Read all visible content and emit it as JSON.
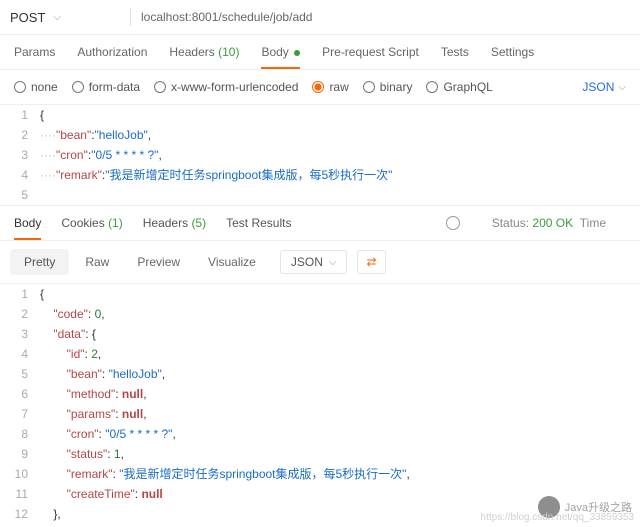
{
  "top": {
    "method": "POST",
    "url": "localhost:8001/schedule/job/add"
  },
  "tabs1": {
    "items": [
      "Params",
      "Authorization",
      "Headers",
      "Body",
      "Pre-request Script",
      "Tests",
      "Settings"
    ],
    "headersCount": "(10)"
  },
  "radios": {
    "items": [
      "none",
      "form-data",
      "x-www-form-urlencoded",
      "raw",
      "binary",
      "GraphQL"
    ],
    "jsonSel": "JSON"
  },
  "reqBody": {
    "lines": [
      "1",
      "2",
      "3",
      "4",
      "5"
    ],
    "beanK": "\"bean\"",
    "beanV": "\"helloJob\"",
    "cronK": "\"cron\"",
    "cronV": "\"0/5 * * * * ?\"",
    "remarkK": "\"remark\"",
    "remarkV": "\"我是新增定时任务springboot集成版，每5秒执行一次\""
  },
  "respHead": {
    "tabs": [
      "Body",
      "Cookies",
      "Headers",
      "Test Results"
    ],
    "cookiesCount": "(1)",
    "headersCount": "(5)",
    "statusLabel": "Status:",
    "statusVal": "200 OK",
    "timeLabel": "Time"
  },
  "viewTabs": {
    "pretty": "Pretty",
    "raw": "Raw",
    "preview": "Preview",
    "visualize": "Visualize",
    "fmt": "JSON"
  },
  "respBody": {
    "codeK": "\"code\"",
    "codeV": "0",
    "dataK": "\"data\"",
    "idK": "\"id\"",
    "idV": "2",
    "beanK": "\"bean\"",
    "beanV": "\"helloJob\"",
    "methodK": "\"method\"",
    "methodV": "null",
    "paramsK": "\"params\"",
    "paramsV": "null",
    "cronK": "\"cron\"",
    "cronV": "\"0/5 * * * * ?\"",
    "statusK": "\"status\"",
    "statusV": "1",
    "remarkK": "\"remark\"",
    "remarkV": "\"我是新增定时任务springboot集成版，每5秒执行一次\"",
    "createTimeK": "\"createTime\"",
    "createTimeV": "null"
  },
  "watermark": "Java升级之路",
  "subwm": "https://blog.csdn.net/qq_33859353",
  "chart_data": null
}
